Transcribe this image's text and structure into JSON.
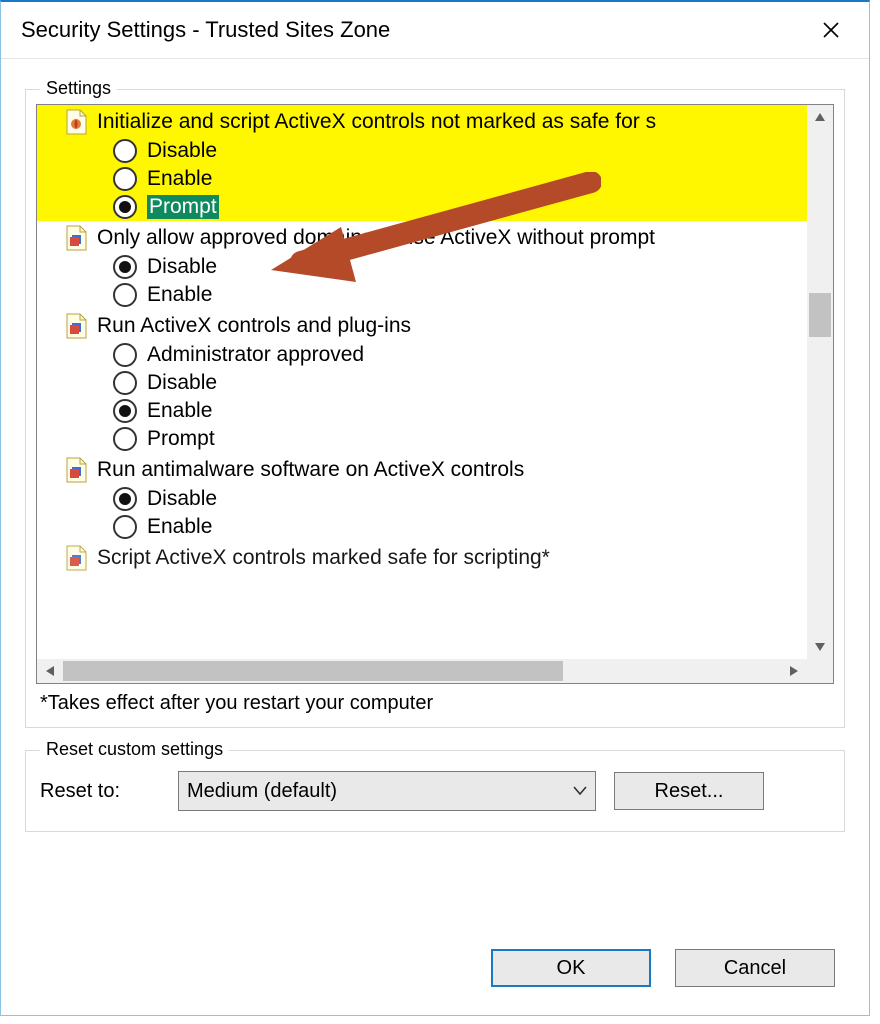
{
  "window": {
    "title": "Security Settings - Trusted Sites Zone"
  },
  "settings_group": {
    "legend": "Settings",
    "footnote": "*Takes effect after you restart your computer",
    "items": [
      {
        "label": "Initialize and script ActiveX controls not marked as safe for s",
        "highlight": true,
        "options": [
          {
            "label": "Disable",
            "selected": false
          },
          {
            "label": "Enable",
            "selected": false
          },
          {
            "label": "Prompt",
            "selected": true,
            "emphasis": true
          }
        ]
      },
      {
        "label": "Only allow approved domains to use ActiveX without prompt",
        "options": [
          {
            "label": "Disable",
            "selected": true
          },
          {
            "label": "Enable",
            "selected": false
          }
        ]
      },
      {
        "label": "Run ActiveX controls and plug-ins",
        "options": [
          {
            "label": "Administrator approved",
            "selected": false
          },
          {
            "label": "Disable",
            "selected": false
          },
          {
            "label": "Enable",
            "selected": true
          },
          {
            "label": "Prompt",
            "selected": false
          }
        ]
      },
      {
        "label": "Run antimalware software on ActiveX controls",
        "options": [
          {
            "label": "Disable",
            "selected": true
          },
          {
            "label": "Enable",
            "selected": false
          }
        ]
      },
      {
        "label": "Script ActiveX controls marked safe for scripting*",
        "partial": true,
        "options": []
      }
    ]
  },
  "reset_group": {
    "legend": "Reset custom settings",
    "reset_to_label": "Reset to:",
    "select_value": "Medium (default)",
    "reset_button": "Reset..."
  },
  "footer": {
    "ok": "OK",
    "cancel": "Cancel"
  }
}
